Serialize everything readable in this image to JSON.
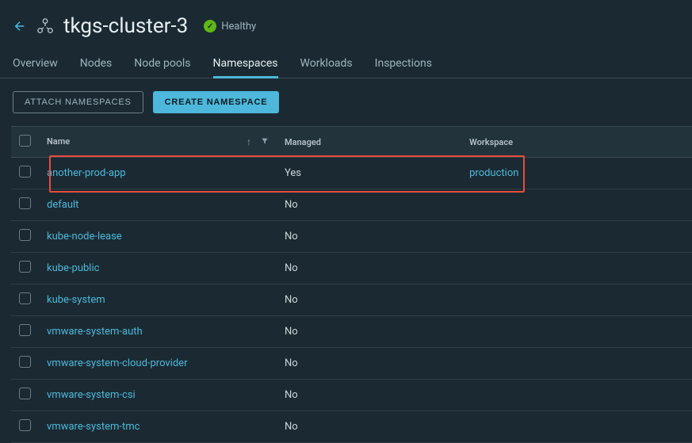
{
  "header": {
    "title": "tkgs-cluster-3",
    "status": "Healthy"
  },
  "tabs": [
    {
      "label": "Overview",
      "active": false
    },
    {
      "label": "Nodes",
      "active": false
    },
    {
      "label": "Node pools",
      "active": false
    },
    {
      "label": "Namespaces",
      "active": true
    },
    {
      "label": "Workloads",
      "active": false
    },
    {
      "label": "Inspections",
      "active": false
    }
  ],
  "actions": {
    "attach": "ATTACH NAMESPACES",
    "create": "CREATE NAMESPACE"
  },
  "columns": {
    "name": "Name",
    "managed": "Managed",
    "workspace": "Workspace"
  },
  "rows": [
    {
      "name": "another-prod-app",
      "managed": "Yes",
      "workspace": "production",
      "highlighted": true
    },
    {
      "name": "default",
      "managed": "No",
      "workspace": ""
    },
    {
      "name": "kube-node-lease",
      "managed": "No",
      "workspace": ""
    },
    {
      "name": "kube-public",
      "managed": "No",
      "workspace": ""
    },
    {
      "name": "kube-system",
      "managed": "No",
      "workspace": ""
    },
    {
      "name": "vmware-system-auth",
      "managed": "No",
      "workspace": ""
    },
    {
      "name": "vmware-system-cloud-provider",
      "managed": "No",
      "workspace": ""
    },
    {
      "name": "vmware-system-csi",
      "managed": "No",
      "workspace": ""
    },
    {
      "name": "vmware-system-tmc",
      "managed": "No",
      "workspace": ""
    }
  ]
}
